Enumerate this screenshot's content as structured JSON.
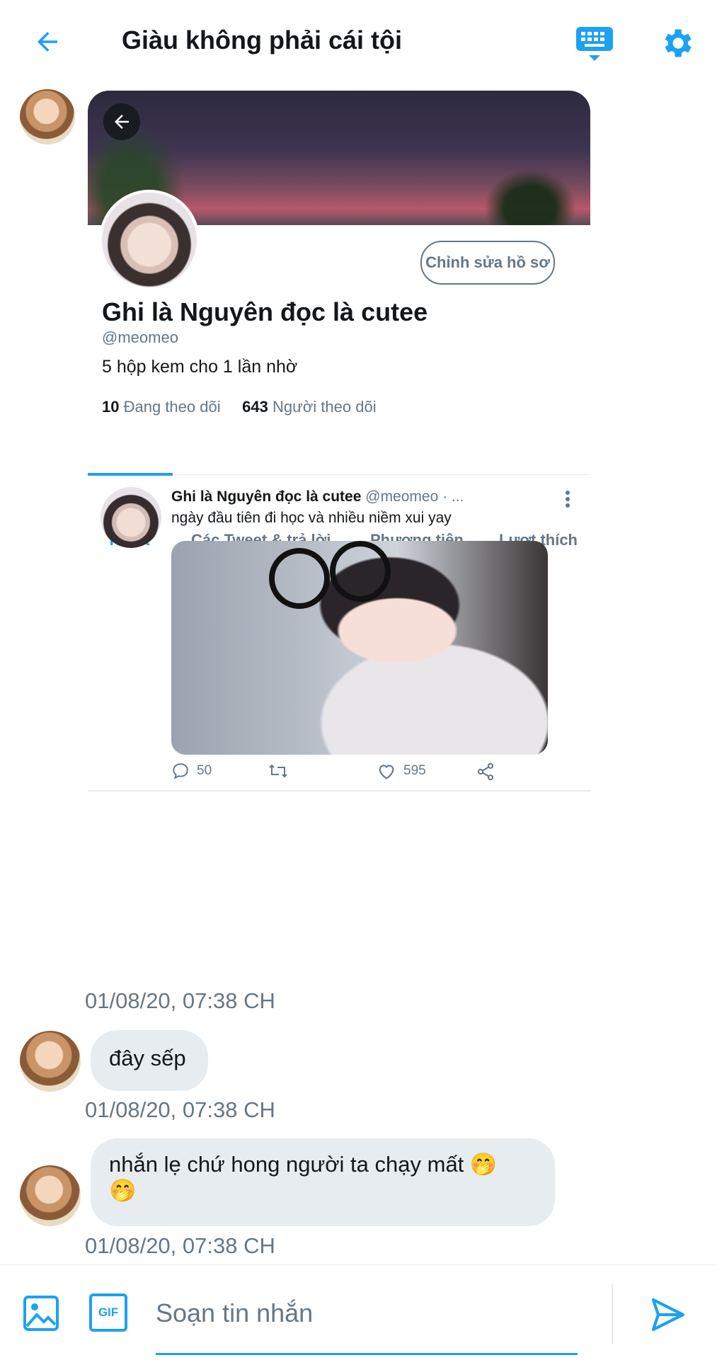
{
  "header": {
    "title": "Giàu không phải cái tội",
    "back_icon": "arrow-left-icon",
    "keyboard_icon": "keyboard-icon",
    "settings_icon": "gear-icon"
  },
  "shared_profile": {
    "edit_button": "Chỉnh sửa hồ sơ",
    "name": "Ghi là Nguyên đọc là cutee",
    "handle": "@meomeo",
    "bio": "5 hộp kem cho 1 lần nhờ",
    "following_count": "10",
    "following_label": "Đang theo dõi",
    "followers_count": "643",
    "followers_label": "Người theo dõi",
    "tabs": [
      "Tweet",
      "Các Tweet & trả lời",
      "Phương tiện",
      "Lượt thích"
    ],
    "active_tab": "Tweet",
    "tweet": {
      "author": "Ghi là Nguyên đọc là cutee",
      "handle_suffix": "@meomeo · ...",
      "text": "ngày đầu tiên đi học và nhiều niềm xui yay",
      "reply_count": "50",
      "like_count": "595"
    }
  },
  "messages": [
    {
      "timestamp": "01/08/20, 07:38 CH"
    },
    {
      "text": "đây sếp",
      "timestamp": "01/08/20, 07:38 CH"
    },
    {
      "text_line1": "nhắn lẹ chứ hong người ta chạy mất 🤭",
      "text_line2": "🤭",
      "timestamp": "01/08/20, 07:38 CH"
    }
  ],
  "composer": {
    "placeholder": "Soạn tin nhắn",
    "gif_label": "GIF"
  },
  "colors": {
    "accent": "#1da1f2",
    "secondary_text": "#657786",
    "bubble": "#e6ecf0"
  }
}
